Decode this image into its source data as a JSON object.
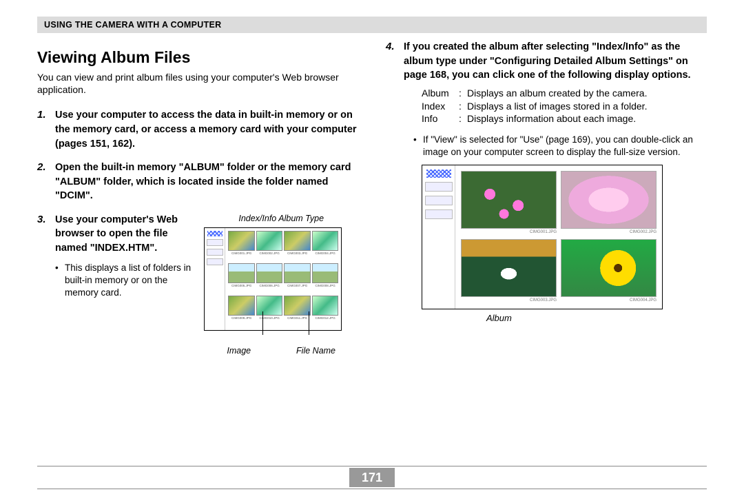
{
  "header": "USING THE CAMERA WITH A COMPUTER",
  "left": {
    "title": "Viewing Album Files",
    "intro": "You can view and print album files using your computer's Web browser application.",
    "step1": "Use your computer to access the data in built-in memory or on the memory card, or access a memory card with your computer (pages 151, 162).",
    "step2": "Open the built-in memory \"ALBUM\" folder or the memory card \"ALBUM\" folder, which is located inside the folder named \"DCIM\".",
    "step3": "Use your computer's Web browser to open the file named \"INDEX.HTM\".",
    "step3_sub": "This displays a list of folders in built-in memory or on the memory card.",
    "fig1_top": "Index/Info Album Type",
    "fig1_image": "Image",
    "fig1_filename": "File Name"
  },
  "right": {
    "step4": "If you created the album after selecting \"Index/Info\" as the album type under \"Configuring Detailed Album Settings\" on page 168, you can click one of the following display options.",
    "defs": [
      {
        "term": "Album",
        "desc": "Displays an album created by the camera."
      },
      {
        "term": "Index",
        "desc": "Displays a list of images stored in a folder."
      },
      {
        "term": "Info",
        "desc": "Displays information about each image."
      }
    ],
    "bullet": "If \"View\" is selected for \"Use\" (page 169), you can double-click an image on your computer screen to display the full-size version.",
    "fig2_caption": "Album"
  },
  "page_number": "171",
  "num1": "1.",
  "num2": "2.",
  "num3": "3.",
  "num4": "4."
}
